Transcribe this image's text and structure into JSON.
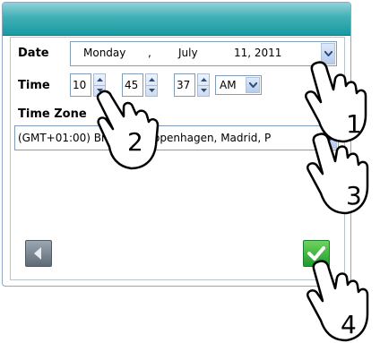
{
  "form": {
    "date_label": "Date",
    "date": {
      "weekday": "Monday",
      "sep1": ",",
      "month": "July",
      "day_year": "11, 2011"
    },
    "time_label": "Time",
    "time": {
      "hour": "10",
      "minute": "45",
      "second": "37",
      "ampm": "AM"
    },
    "timezone_label": "Time Zone",
    "timezone_value": "(GMT+01:00) Brussels, Copenhagen, Madrid, P"
  },
  "callouts": [
    "1",
    "2",
    "3",
    "4"
  ],
  "colors": {
    "titlebar": "#1a99a2",
    "back_button": "#6f7c87",
    "ok_button": "#2ea33a"
  }
}
